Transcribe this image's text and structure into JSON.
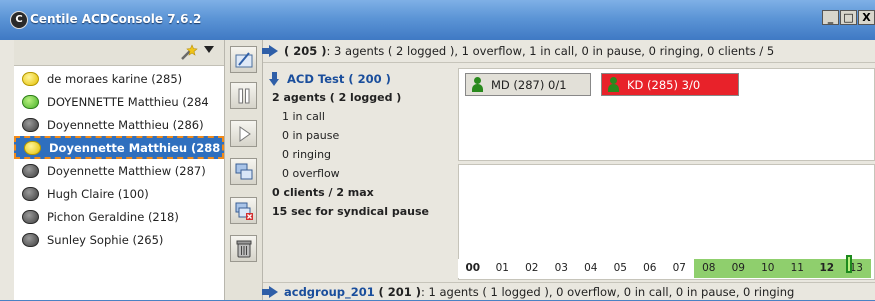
{
  "window": {
    "title": "Centile ACDConsole 7.6.2",
    "logo_letter": "C",
    "minimize": "_",
    "maximize": "□",
    "close": "X"
  },
  "agents": [
    {
      "name": "de moraes karine (285)",
      "status": "yellow"
    },
    {
      "name": "DOYENNETTE Matthieu (284",
      "status": "green"
    },
    {
      "name": "Doyennette Matthieu (286)",
      "status": "gray"
    },
    {
      "name": "Doyennette Matthieu (288",
      "status": "yellow",
      "selected": true
    },
    {
      "name": "Doyennette Matthiew (287)",
      "status": "gray"
    },
    {
      "name": "Hugh Claire (100)",
      "status": "gray"
    },
    {
      "name": "Pichon Geraldine (218)",
      "status": "gray"
    },
    {
      "name": "Sunley Sophie (265)",
      "status": "gray"
    }
  ],
  "summary": {
    "count": "( 205 )",
    "text": " : 3 agents ( 2 logged ), 1 overflow, 1 in call, 0 in pause, 0 ringing, 0 clients / 5"
  },
  "group": {
    "title": "ACD Test ( 200 )",
    "agents_line": "2 agents ( 2 logged )",
    "in_call": "1 in call",
    "in_pause": "0 in pause",
    "ringing": "0 ringing",
    "overflow": "0 overflow",
    "clients": "0 clients / 2 max",
    "pause": "15 sec for syndical pause"
  },
  "chips": [
    {
      "label": "MD (287)  0/1",
      "color": "gray"
    },
    {
      "label": "KD (285)  3/0",
      "color": "red"
    }
  ],
  "hours": [
    "00",
    "01",
    "02",
    "03",
    "04",
    "05",
    "06",
    "07",
    "08",
    "09",
    "10",
    "11",
    "12",
    "13"
  ],
  "hours_active_from": 8,
  "hours_current": 12,
  "bottom": {
    "name": "acdgroup_201",
    "count": "( 201 )",
    "text": " : 1 agents ( 1 logged ), 0 overflow, 0 in call, 0 in pause, 0 ringing"
  }
}
